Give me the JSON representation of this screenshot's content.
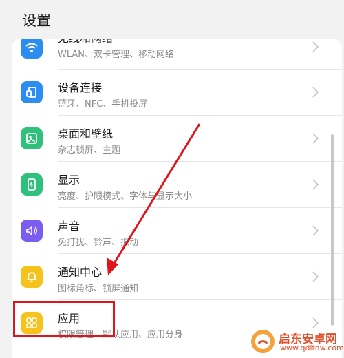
{
  "header": {
    "title": "设置"
  },
  "items": [
    {
      "label": "无线和网络",
      "sub": "WLAN、双卡管理、移动网络",
      "icon": "wifi-icon",
      "color": "#2b8cf2"
    },
    {
      "label": "设备连接",
      "sub": "蓝牙、NFC、手机投屏",
      "icon": "device-connection-icon",
      "color": "#2b8cf2"
    },
    {
      "label": "桌面和壁纸",
      "sub": "杂志锁屏、主题",
      "icon": "wallpaper-icon",
      "color": "#2fc07c"
    },
    {
      "label": "显示",
      "sub": "亮度、护眼模式、字体与显示大小",
      "icon": "display-icon",
      "color": "#2fc07c"
    },
    {
      "label": "声音",
      "sub": "免打扰、铃声、振动",
      "icon": "sound-icon",
      "color": "#7a5cf0"
    },
    {
      "label": "通知中心",
      "sub": "图标角标、锁屏通知",
      "icon": "bell-icon",
      "color": "#f6c21c"
    },
    {
      "label": "应用",
      "sub": "权限管理、默认应用、应用分身",
      "icon": "apps-grid-icon",
      "color": "#f6c21c"
    }
  ],
  "colors": {
    "highlight": "#e0151b",
    "arrow": "#e0151b"
  },
  "watermark": {
    "title": "启东安卓网",
    "url": "www.qdltdw.com"
  }
}
